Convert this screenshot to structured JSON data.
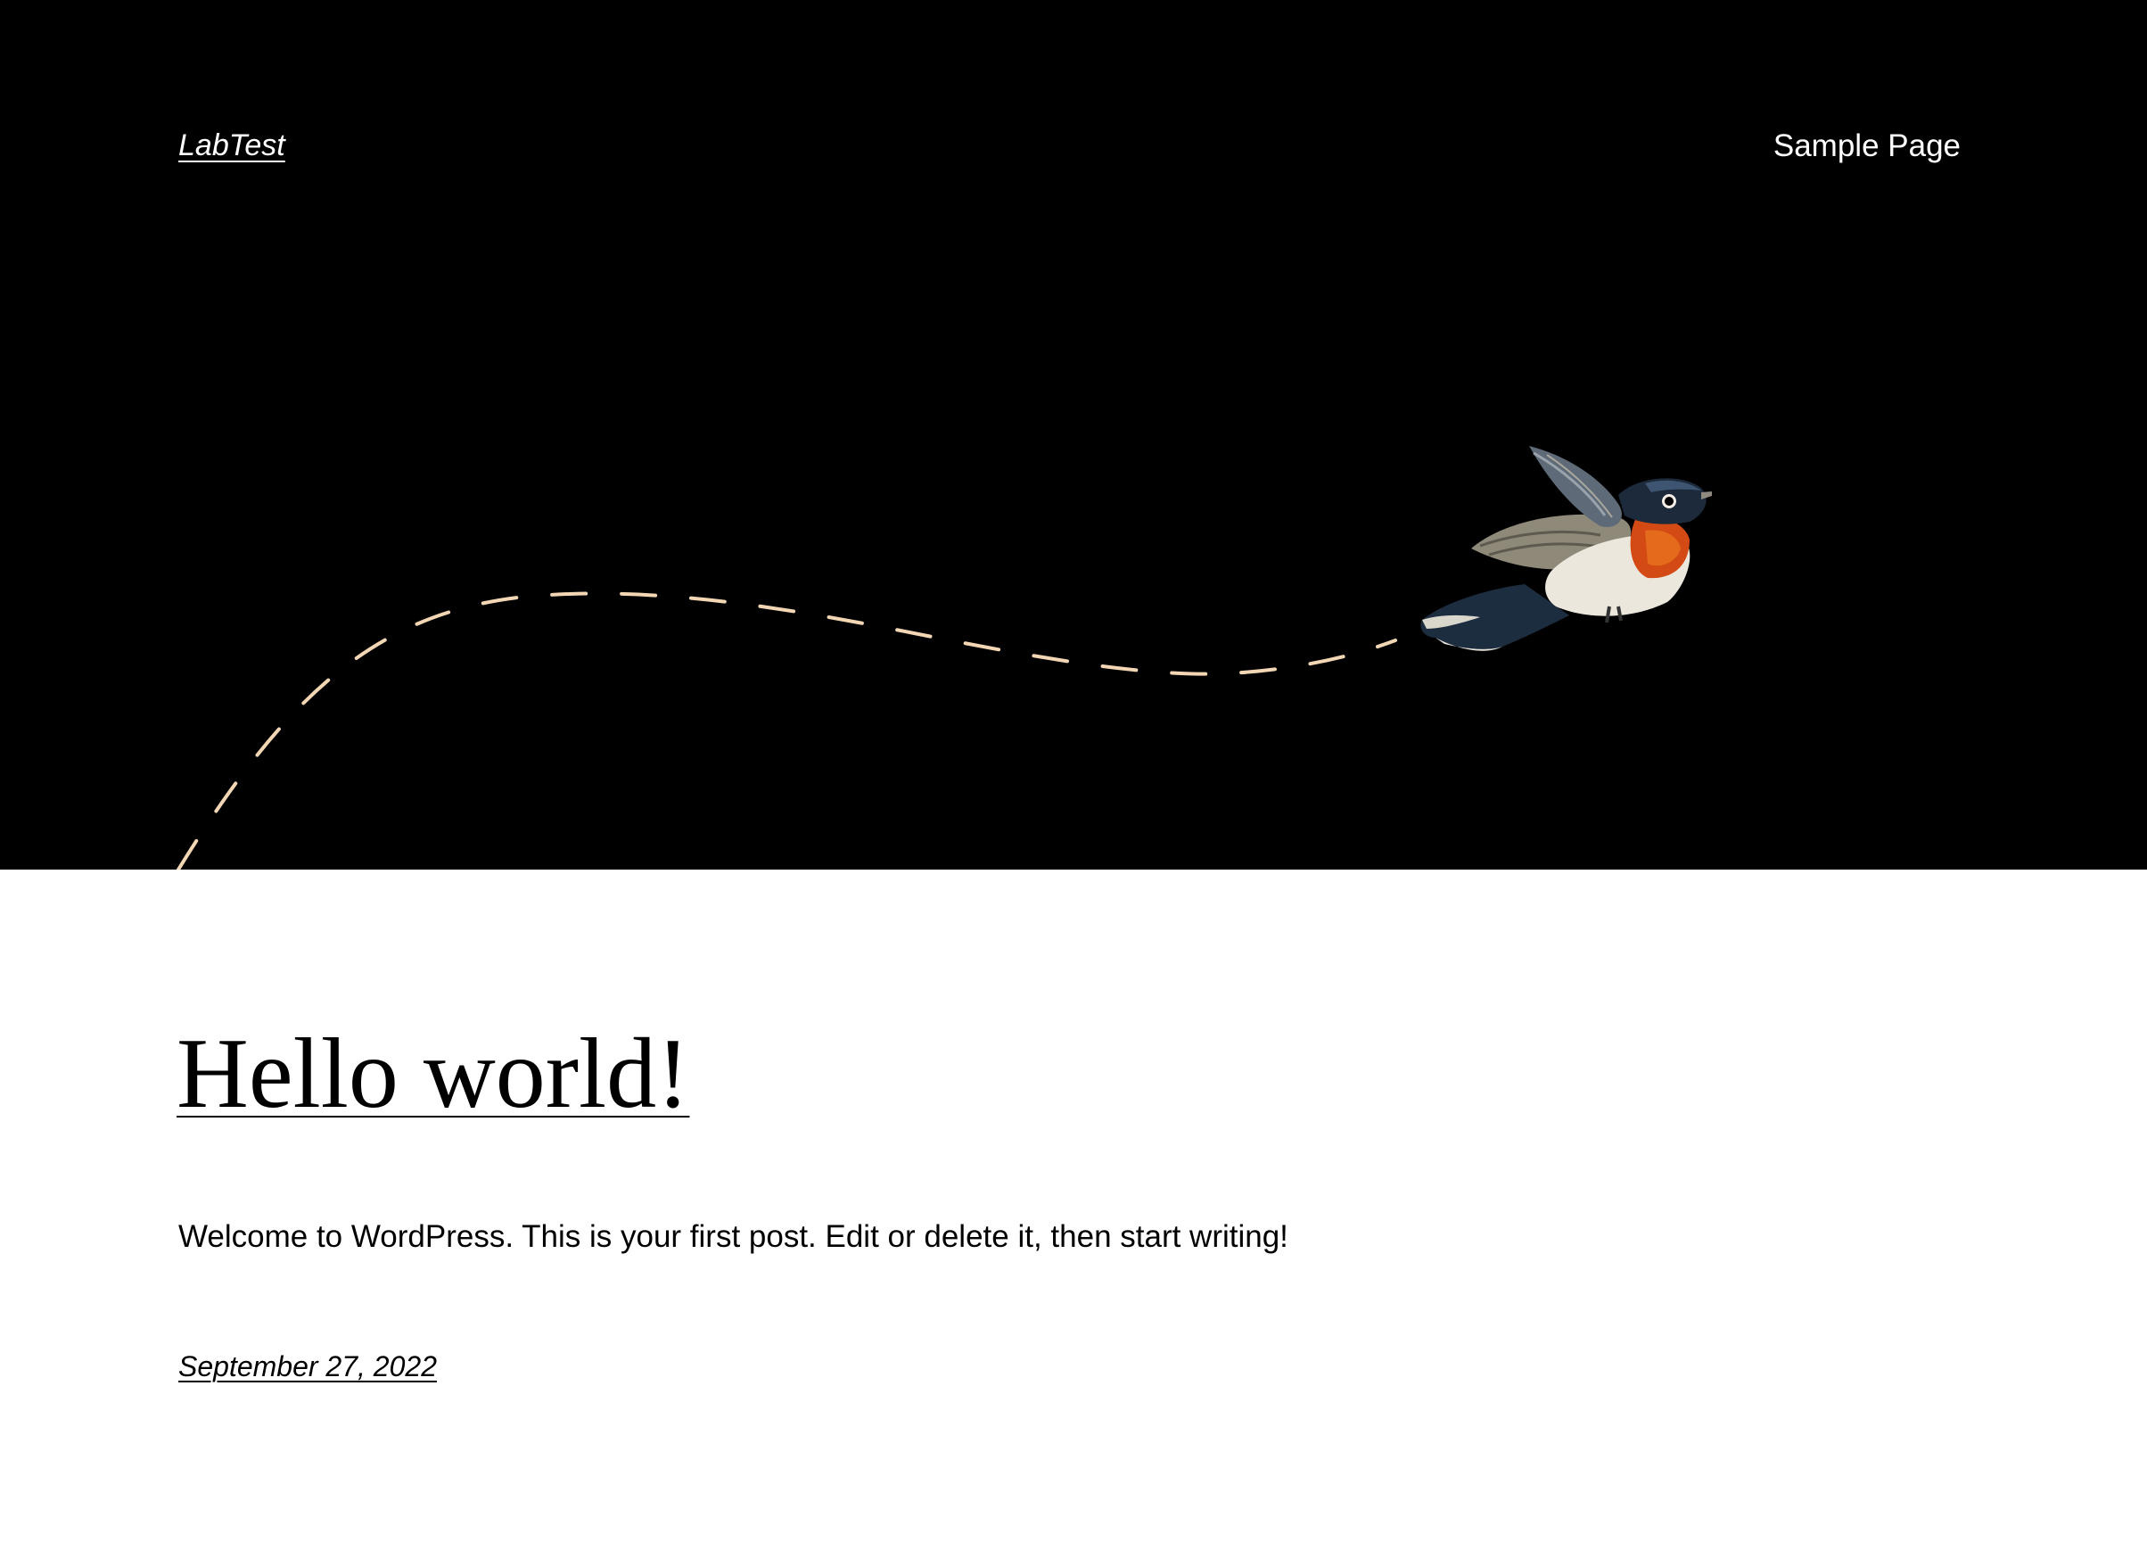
{
  "header": {
    "site_title": "LabTest",
    "nav": {
      "items": [
        "Sample Page"
      ]
    }
  },
  "hero": {
    "background_color": "#000000",
    "path_color": "#f3d7b4",
    "illustration": "flying-bird-icon"
  },
  "post": {
    "title": "Hello world!",
    "excerpt": "Welcome to WordPress. This is your first post. Edit or delete it, then start writing!",
    "date": "September 27, 2022"
  }
}
